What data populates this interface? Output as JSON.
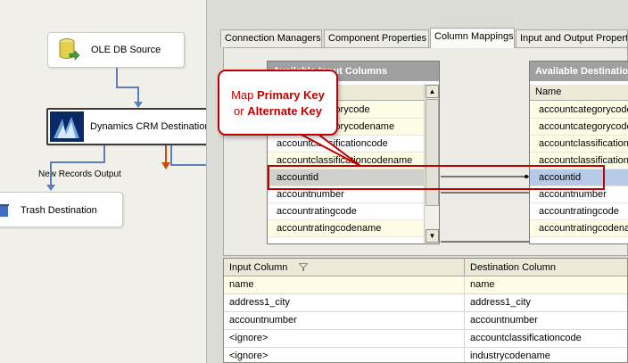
{
  "canvas": {
    "ole_db_source_label": "OLE DB Source",
    "crm_destination_label": "Dynamics CRM Destination",
    "path_label": "New Records Output",
    "trash_destination_label": "Trash Destination"
  },
  "tabs": [
    {
      "label": "Connection Managers"
    },
    {
      "label": "Component Properties"
    },
    {
      "label": "Column Mappings"
    },
    {
      "label": "Input and Output Properties"
    }
  ],
  "available_input": {
    "title": "Available Input Columns",
    "header": "Name",
    "rows": [
      "accountcategorycode",
      "accountcategorycodename",
      "accountclassificationcode",
      "accountclassificationcodename",
      "accountid",
      "accountnumber",
      "accountratingcode",
      "accountratingcodename"
    ]
  },
  "available_destination": {
    "title": "Available Destination Columns",
    "header": "Name",
    "rows": [
      "accountcategorycode",
      "accountcategorycodename",
      "accountclassificationcode",
      "accountclassificationcodename",
      "accountid",
      "accountnumber",
      "accountratingcode",
      "accountratingcodename"
    ]
  },
  "callout": {
    "line1_prefix": "Map",
    "line1_bold": "Primary Key",
    "line2_prefix": "or",
    "line2_bold": "Alternate Key"
  },
  "mapping_grid": {
    "headers": [
      "Input Column",
      "Destination Column"
    ],
    "sort_icon": "funnel-icon",
    "rows": [
      [
        "name",
        "name"
      ],
      [
        "address1_city",
        "address1_city"
      ],
      [
        "accountnumber",
        "accountnumber"
      ],
      [
        "<ignore>",
        "accountclassificationcode"
      ],
      [
        "<ignore>",
        "industrycodename"
      ]
    ]
  },
  "colors": {
    "accent_red": "#c00000",
    "connector_blue": "#5b7fb8",
    "error_red": "#cc4a10"
  }
}
